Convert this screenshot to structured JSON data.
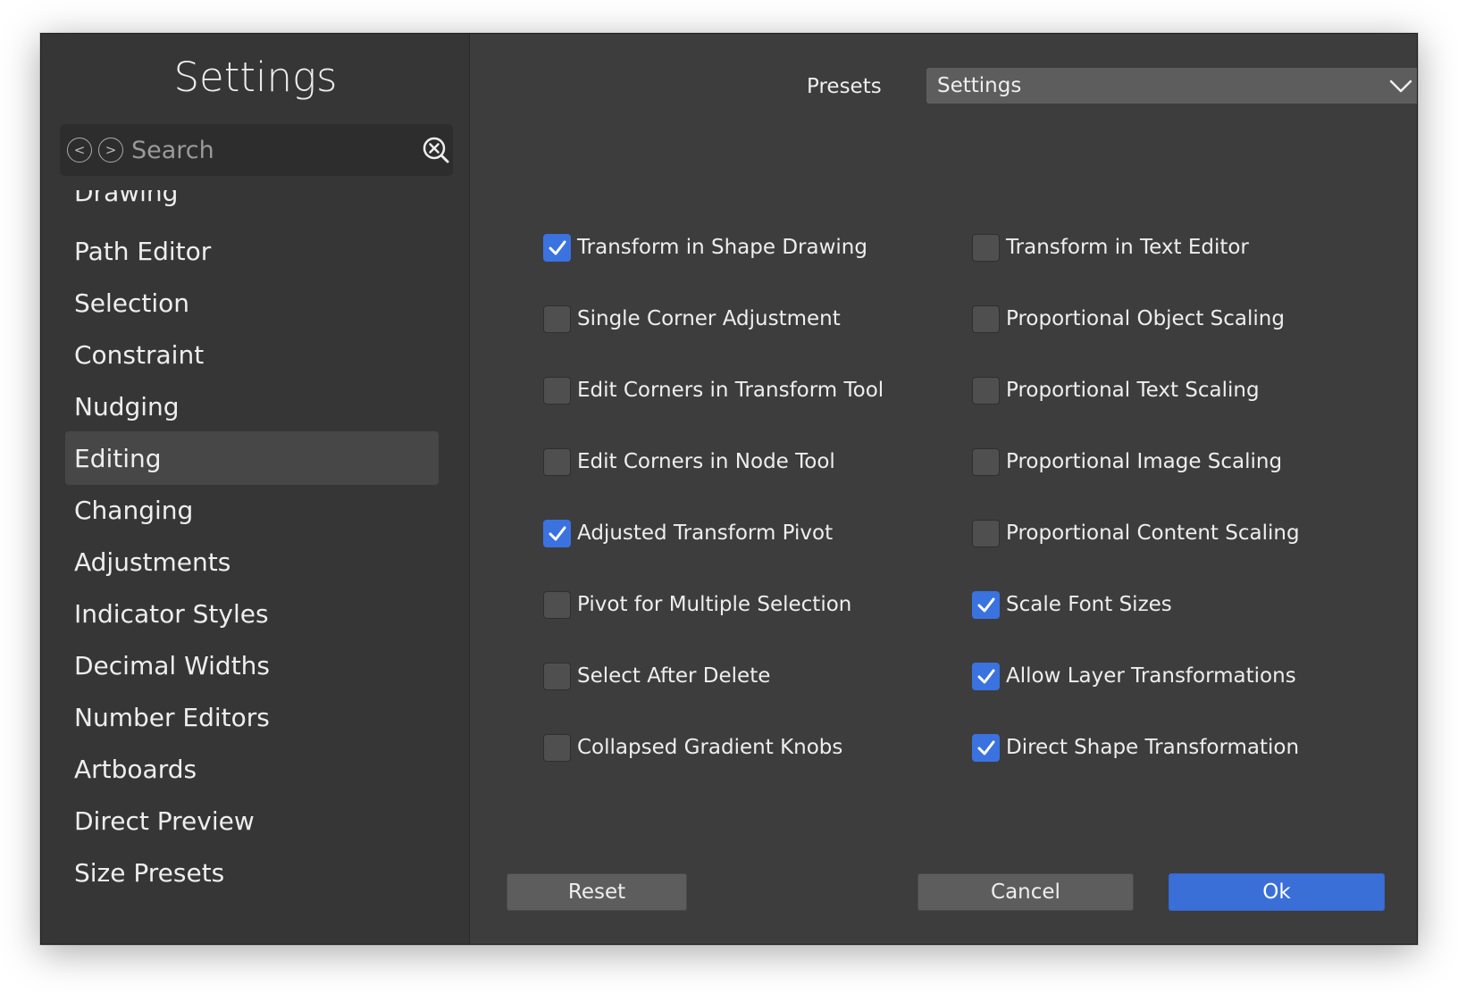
{
  "sidebar": {
    "title": "Settings",
    "search_placeholder": "Search",
    "back_glyph": "<",
    "forward_glyph": ">",
    "items": [
      {
        "label": "Drawing",
        "selected": false
      },
      {
        "label": "Path Editor",
        "selected": false
      },
      {
        "label": "Selection",
        "selected": false
      },
      {
        "label": "Constraint",
        "selected": false
      },
      {
        "label": "Nudging",
        "selected": false
      },
      {
        "label": "Editing",
        "selected": true
      },
      {
        "label": "Changing",
        "selected": false
      },
      {
        "label": "Adjustments",
        "selected": false
      },
      {
        "label": "Indicator Styles",
        "selected": false
      },
      {
        "label": "Decimal Widths",
        "selected": false
      },
      {
        "label": "Number Editors",
        "selected": false
      },
      {
        "label": "Artboards",
        "selected": false
      },
      {
        "label": "Direct Preview",
        "selected": false
      },
      {
        "label": "Size Presets",
        "selected": false
      }
    ]
  },
  "presets": {
    "label": "Presets",
    "value": "Settings"
  },
  "options": {
    "left": [
      {
        "label": "Transform in Shape Drawing",
        "checked": true
      },
      {
        "label": "Single Corner Adjustment",
        "checked": false
      },
      {
        "label": "Edit Corners in Transform Tool",
        "checked": false
      },
      {
        "label": "Edit Corners in Node Tool",
        "checked": false
      },
      {
        "label": "Adjusted Transform Pivot",
        "checked": true
      },
      {
        "label": "Pivot for Multiple Selection",
        "checked": false
      },
      {
        "label": "Select After Delete",
        "checked": false
      },
      {
        "label": "Collapsed Gradient Knobs",
        "checked": false
      }
    ],
    "right": [
      {
        "label": "Transform in Text Editor",
        "checked": false
      },
      {
        "label": "Proportional Object Scaling",
        "checked": false
      },
      {
        "label": "Proportional Text Scaling",
        "checked": false
      },
      {
        "label": "Proportional Image Scaling",
        "checked": false
      },
      {
        "label": "Proportional Content Scaling",
        "checked": false
      },
      {
        "label": "Scale Font Sizes",
        "checked": true
      },
      {
        "label": "Allow Layer Transformations",
        "checked": true
      },
      {
        "label": "Direct Shape Transformation",
        "checked": true
      }
    ]
  },
  "buttons": {
    "reset": "Reset",
    "cancel": "Cancel",
    "ok": "Ok"
  },
  "colors": {
    "accent": "#3a72e0",
    "window_bg": "#3d3d3d",
    "sidebar_bg": "#363636"
  }
}
